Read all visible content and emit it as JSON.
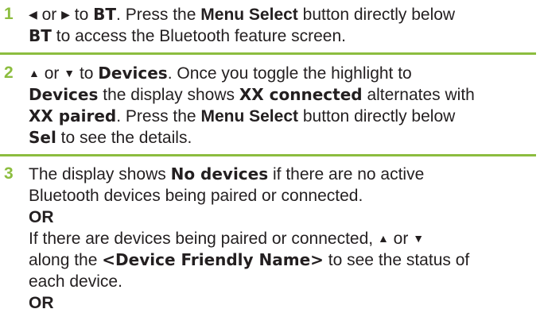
{
  "colors": {
    "accent": "#8cbd3f",
    "text": "#231f20"
  },
  "icons": {
    "left_arrow": "◀",
    "right_arrow": "▶",
    "up_arrow": "▲",
    "down_arrow": "▼"
  },
  "step1": {
    "number": "1",
    "or": "or",
    "to": "to",
    "bt": "BT",
    "after_bt": ". Press the",
    "menu_select": "Menu Select",
    "button_below": "button directly below",
    "bt2": "BT",
    "access": "to access the Bluetooth feature screen."
  },
  "step2": {
    "number": "2",
    "or": "or",
    "to": "to",
    "devices": "Devices",
    "toggle_text": ". Once you toggle the highlight to",
    "devices2": "Devices",
    "display_shows": "the display shows",
    "xx_connected": "XX connected",
    "alternates": "alternates with",
    "xx_paired": "XX paired",
    "press": ". Press the",
    "menu_select": "Menu Select",
    "button_below": "button directly below",
    "sel": "Sel",
    "see_details": "to see the details."
  },
  "step3": {
    "number": "3",
    "display_shows": "The display shows",
    "no_devices": "No devices",
    "no_active": "if there are no active Bluetooth devices being paired or connected.",
    "or1": "OR",
    "if_devices": "If there are devices being paired or connected,",
    "or": "or",
    "along": "along the",
    "friendly_name": "<Device Friendly Name>",
    "status": "to see the status of each device.",
    "or2": "OR"
  }
}
